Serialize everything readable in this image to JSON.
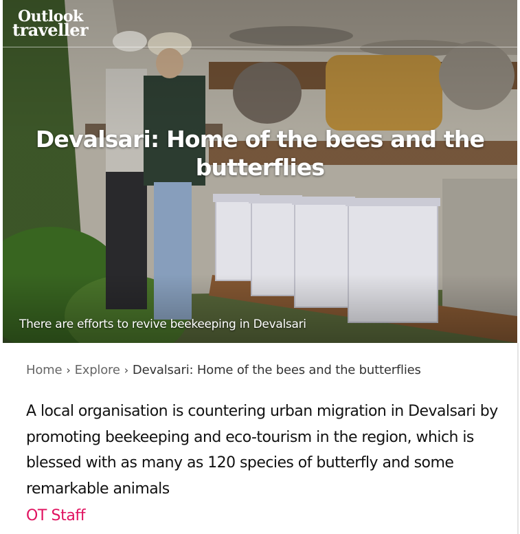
{
  "brand": {
    "logo_line1": "Outlook",
    "logo_line2": "traveller"
  },
  "hero": {
    "title": "Devalsari: Home of the bees and the butterflies",
    "caption": "There are efforts to revive beekeeping in Devalsari"
  },
  "breadcrumb": {
    "items": [
      "Home",
      "Explore"
    ],
    "current": "Devalsari: Home of the bees and the butterflies"
  },
  "article": {
    "standfirst": "A local organisation is countering urban migration in Devalsari by promoting beekeeping and eco-tourism in the region, which is blessed with as many as 120 species of butterfly and some remarkable animals",
    "author": "OT Staff"
  },
  "colors": {
    "author_accent": "#e0115f"
  },
  "icons": {
    "breadcrumb_separator": "chevron-right-icon"
  }
}
